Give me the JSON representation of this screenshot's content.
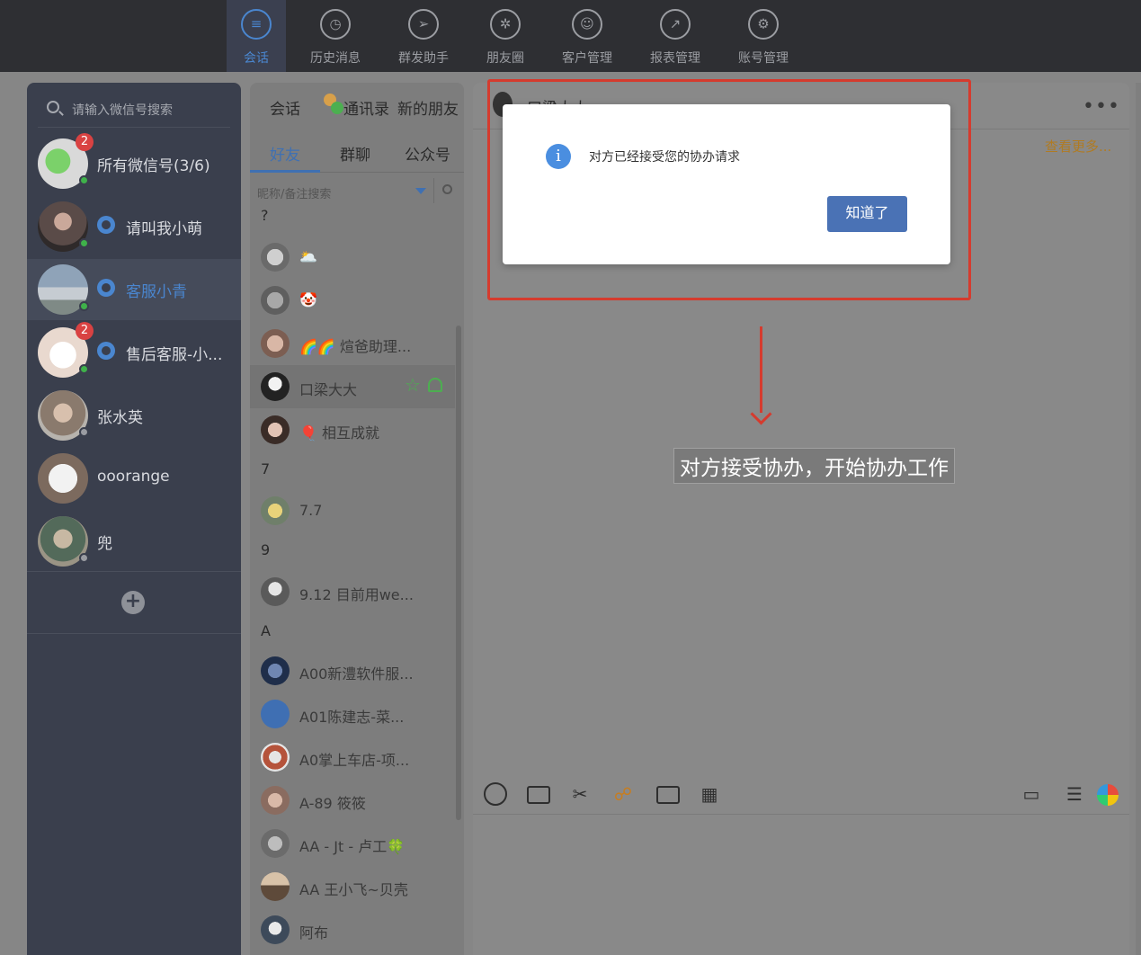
{
  "nav": {
    "items": [
      {
        "label": "会话",
        "icon": "chat-bubble-icon"
      },
      {
        "label": "历史消息",
        "icon": "clock-icon"
      },
      {
        "label": "群发助手",
        "icon": "paper-plane-icon"
      },
      {
        "label": "朋友圈",
        "icon": "aperture-icon"
      },
      {
        "label": "客户管理",
        "icon": "user-icon"
      },
      {
        "label": "报表管理",
        "icon": "chart-icon"
      },
      {
        "label": "账号管理",
        "icon": "gear-icon"
      }
    ],
    "active_color": "#4a86cf"
  },
  "accounts": {
    "search_placeholder": "请输入微信号搜索",
    "items": [
      {
        "name": "所有微信号(3/6)",
        "badge": "2"
      },
      {
        "name": "请叫我小萌"
      },
      {
        "name": "客服小青"
      },
      {
        "name": "售后客服-小...",
        "badge": "2"
      },
      {
        "name": "张水英"
      },
      {
        "name": "ooorange"
      },
      {
        "name": "兜"
      }
    ],
    "add_label": "+"
  },
  "contacts": {
    "tabs": [
      "会话",
      "通讯录",
      "新的朋友"
    ],
    "subtabs": [
      "好友",
      "群聊",
      "公众号"
    ],
    "filter_placeholder": "昵称/备注搜索",
    "letters": {
      "q": "?",
      "seven": "7",
      "nine": "9",
      "a": "A"
    },
    "rows": [
      "🌥️",
      "🤡",
      "🌈🌈 煊爸助理...",
      "口梁大大",
      "🎈 相互成就",
      "7.7",
      "9.12 目前用we...",
      "A00新澧软件服...",
      "A01陈建志-菜...",
      "A0掌上车店-项...",
      "A-89 筱筱",
      "AA - Jt - 卢工🍀",
      "AA 王小飞~贝壳",
      "阿布"
    ]
  },
  "chat": {
    "title": "口梁大大",
    "more": "•••",
    "see_more": "查看更多...",
    "toolbar_icons": [
      "emoji-icon",
      "folder-icon",
      "scissors-icon",
      "assist-users-icon",
      "file-icon",
      "qr-code-icon",
      "comment-icon",
      "card-icon",
      "color-wheel-icon"
    ]
  },
  "dialog": {
    "message": "对方已经接受您的协办请求",
    "ok_label": "知道了",
    "info_glyph": "i"
  },
  "annotation": {
    "caption": "对方接受协办，开始协办工作",
    "color": "#d53b2e"
  }
}
